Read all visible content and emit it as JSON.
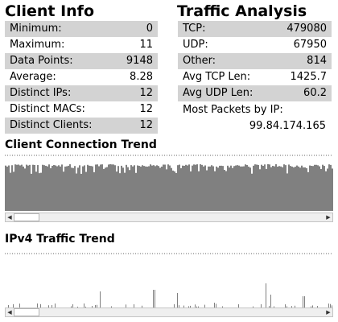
{
  "client_info": {
    "title": "Client Info",
    "rows": [
      {
        "label": "Minimum:",
        "value": "0"
      },
      {
        "label": "Maximum:",
        "value": "11"
      },
      {
        "label": "Data Points:",
        "value": "9148"
      },
      {
        "label": "Average:",
        "value": "8.28"
      },
      {
        "label": "Distinct IPs:",
        "value": "12"
      },
      {
        "label": "Distinct MACs:",
        "value": "12"
      },
      {
        "label": "Distinct Clients:",
        "value": "12"
      }
    ]
  },
  "traffic_analysis": {
    "title": "Traffic Analysis",
    "rows": [
      {
        "label": "TCP:",
        "value": "479080"
      },
      {
        "label": "UDP:",
        "value": "67950"
      },
      {
        "label": "Other:",
        "value": "814"
      },
      {
        "label": "Avg TCP  Len:",
        "value": "1425.7"
      },
      {
        "label": "Avg UDP Len:",
        "value": "60.2"
      }
    ],
    "most_packets_label": "Most Packets by IP:",
    "most_packets_value": "99.84.174.165"
  },
  "client_trend": {
    "title": "Client Connection Trend",
    "bar_color": "#808080"
  },
  "ipv4_trend": {
    "title": "IPv4 Traffic Trend",
    "bar_color": "#808080"
  },
  "scrollbar": {
    "left_arrow": "◀",
    "right_arrow": "▶",
    "scroll_position": 0.0
  },
  "colors": {
    "row_shade": "#d3d3d3",
    "chart_bar": "#808080"
  }
}
